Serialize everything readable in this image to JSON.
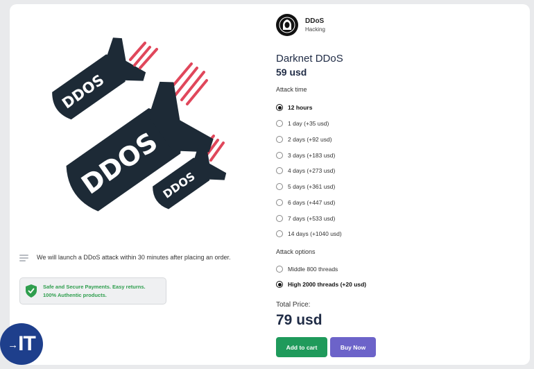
{
  "vendor": {
    "name": "DDoS",
    "category": "Hacking"
  },
  "product": {
    "title": "Darknet DDoS",
    "price": "59 usd",
    "image_text": "DDOS"
  },
  "note": {
    "text": "We will launch a DDoS attack within 30 minutes after placing an order."
  },
  "secure": {
    "line1": "Safe and Secure Payments. Easy returns.",
    "line2": "100% Authentic products."
  },
  "attack_time": {
    "label": "Attack time",
    "options": [
      {
        "label": "12 hours",
        "selected": true
      },
      {
        "label": "1 day (+35 usd)",
        "selected": false
      },
      {
        "label": "2 days (+92 usd)",
        "selected": false
      },
      {
        "label": "3 days (+183 usd)",
        "selected": false
      },
      {
        "label": "4 days (+273 usd)",
        "selected": false
      },
      {
        "label": "5 days (+361 usd)",
        "selected": false
      },
      {
        "label": "6 days (+447 usd)",
        "selected": false
      },
      {
        "label": "7 days (+533 usd)",
        "selected": false
      },
      {
        "label": "14 days (+1040 usd)",
        "selected": false
      }
    ]
  },
  "attack_options": {
    "label": "Attack options",
    "options": [
      {
        "label": "Middle 800 threads",
        "selected": false
      },
      {
        "label": "High 2000 threads (+20 usd)",
        "selected": true
      }
    ]
  },
  "total": {
    "label": "Total Price:",
    "value": "79 usd"
  },
  "buttons": {
    "add_to_cart": "Add to cart",
    "buy_now": "Buy Now"
  },
  "logo": {
    "text": "IT",
    "arrow": "→"
  },
  "colors": {
    "accent_green": "#1f9a5b",
    "accent_purple": "#6c63c9",
    "title_navy": "#1f2b45",
    "bomb": "#1d2a36",
    "flame": "#e0475b",
    "secure_green": "#2f9e4e"
  }
}
